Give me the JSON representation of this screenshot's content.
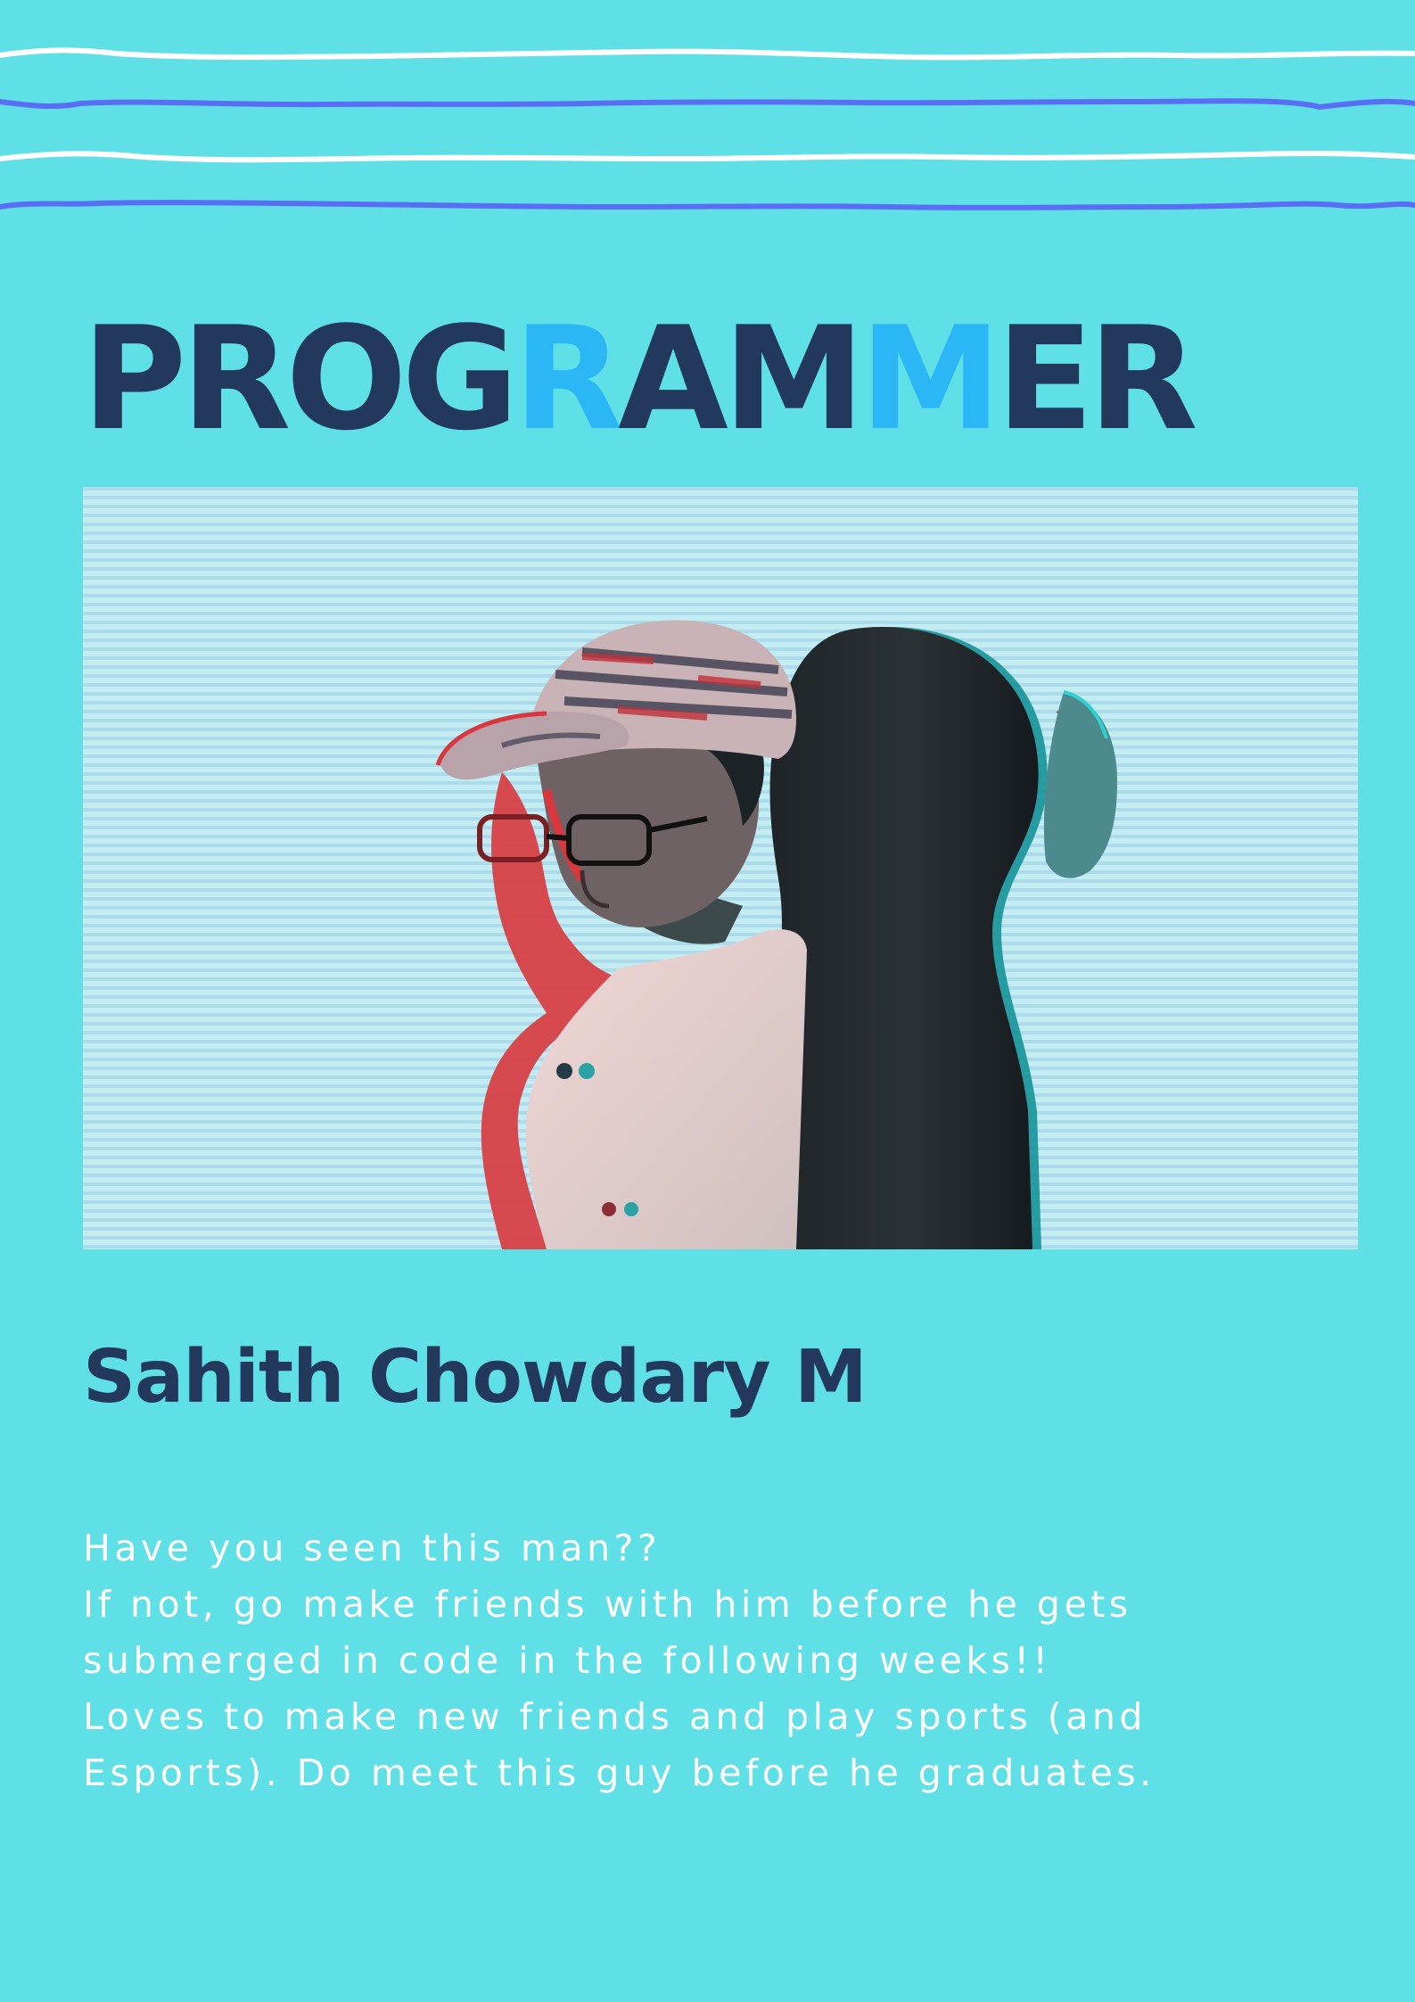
{
  "poster": {
    "title": {
      "segments": [
        {
          "text": "PROG",
          "highlight": false
        },
        {
          "text": "R",
          "highlight": true
        },
        {
          "text": "AM",
          "highlight": false
        },
        {
          "text": "M",
          "highlight": true
        },
        {
          "text": "ER",
          "highlight": false
        }
      ]
    },
    "name": "Sahith Chowdary M",
    "bio": {
      "lines": [
        "Have you seen this man??",
        "If not, go make friends with him before he gets",
        "submerged in code in the following weeks!!",
        "Loves to make new friends and play sports (and",
        "Esports). Do meet this guy before he graduates."
      ]
    },
    "colors": {
      "background": "#5ee0e6",
      "title_dark": "#22395d",
      "title_highlight": "#2bb6f6",
      "wave_white": "#ffffff",
      "wave_blue": "#5a6ef5",
      "body_text": "#ffffff"
    },
    "photo": {
      "description_icon": "glitch-portrait-image"
    }
  }
}
